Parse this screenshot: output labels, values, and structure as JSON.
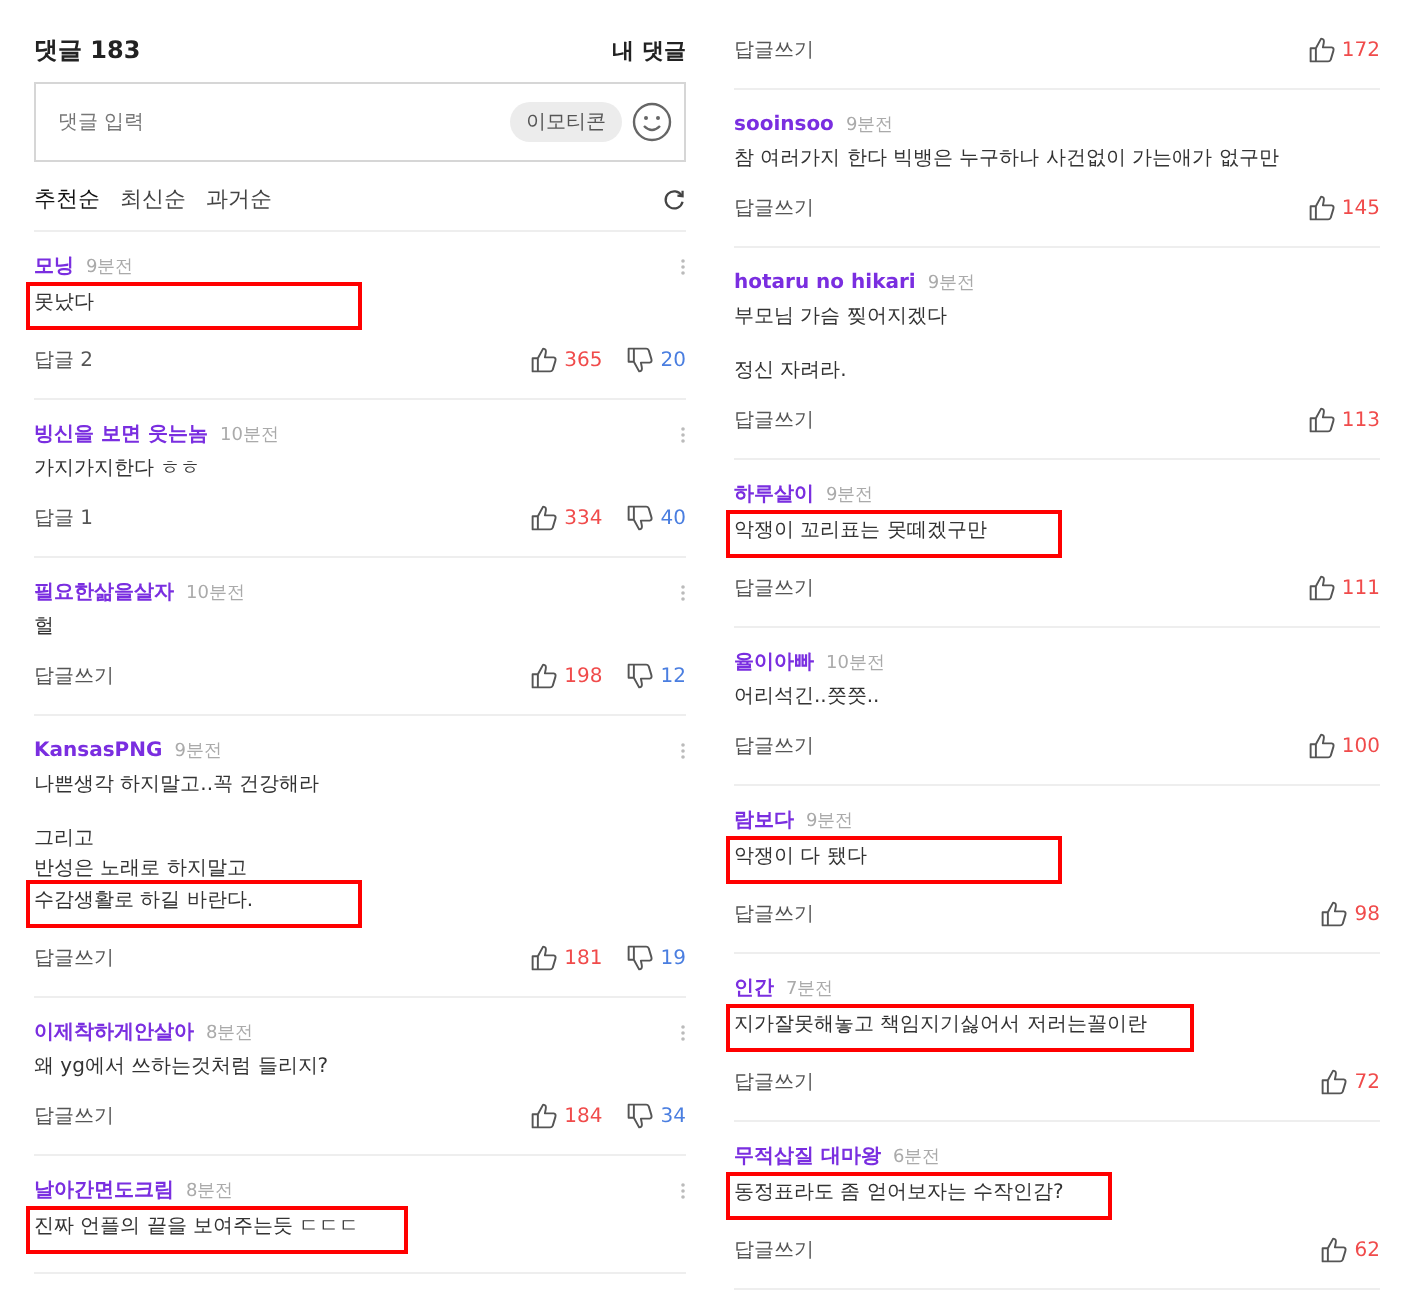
{
  "left_panel": {
    "header": {
      "title": "댓글 183",
      "my_comments": "내 댓글"
    },
    "input": {
      "placeholder": "댓글 입력",
      "emoticon": "이모티콘"
    },
    "sort_tabs": [
      {
        "label": "추천순",
        "selected": true
      },
      {
        "label": "최신순",
        "selected": false
      },
      {
        "label": "과거순",
        "selected": false
      }
    ],
    "show_menu": true,
    "comments": [
      {
        "author": "모닝",
        "time": "9분전",
        "lines": [
          {
            "kind": "text",
            "text": "못났다",
            "highlighted": true
          }
        ],
        "reply": "답글 2",
        "likes": "365",
        "dislikes": "20"
      },
      {
        "author": "빙신을 보면 웃는놈",
        "time": "10분전",
        "lines": [
          {
            "kind": "text",
            "text": "가지가지한다 ㅎㅎ",
            "highlighted": false
          }
        ],
        "reply": "답글 1",
        "likes": "334",
        "dislikes": "40"
      },
      {
        "author": "필요한삶을살자",
        "time": "10분전",
        "lines": [
          {
            "kind": "text",
            "text": "헐",
            "highlighted": false
          }
        ],
        "reply": "답글쓰기",
        "likes": "198",
        "dislikes": "12"
      },
      {
        "author": "KansasPNG",
        "time": "9분전",
        "lines": [
          {
            "kind": "text",
            "text": "나쁜생각 하지말고..꼭 건강해라",
            "highlighted": false
          },
          {
            "kind": "blank"
          },
          {
            "kind": "text",
            "text": "그리고",
            "highlighted": false
          },
          {
            "kind": "text",
            "text": "반성은 노래로 하지말고",
            "highlighted": false
          },
          {
            "kind": "text",
            "text": "수감생활로 하길 바란다.",
            "highlighted": true
          }
        ],
        "reply": "답글쓰기",
        "likes": "181",
        "dislikes": "19"
      },
      {
        "author": "이제착하게안살아",
        "time": "8분전",
        "lines": [
          {
            "kind": "text",
            "text": "왜 yg에서 쓰하는것처럼 들리지?",
            "highlighted": false
          }
        ],
        "reply": "답글쓰기",
        "likes": "184",
        "dislikes": "34"
      },
      {
        "author": "날아간면도크림",
        "time": "8분전",
        "lines": [
          {
            "kind": "text",
            "text": "진짜 언플의 끝을 보여주는듯 ㄷㄷㄷ",
            "highlighted": true
          }
        ]
      }
    ]
  },
  "right_panel": {
    "show_menu": false,
    "comments": [
      {
        "reply": "답글쓰기",
        "likes": "172"
      },
      {
        "author": "sooinsoo",
        "time": "9분전",
        "lines": [
          {
            "kind": "text",
            "text": "참 여러가지 한다 빅뱅은 누구하나 사건없이 가는애가 없구만",
            "highlighted": false
          }
        ],
        "reply": "답글쓰기",
        "likes": "145"
      },
      {
        "author": "hotaru no hikari",
        "time": "9분전",
        "lines": [
          {
            "kind": "text",
            "text": "부모님 가슴 찢어지겠다",
            "highlighted": false
          },
          {
            "kind": "blank"
          },
          {
            "kind": "text",
            "text": "정신 자려라.",
            "highlighted": false
          }
        ],
        "reply": "답글쓰기",
        "likes": "113"
      },
      {
        "author": "하루살이",
        "time": "9분전",
        "lines": [
          {
            "kind": "text",
            "text": "악쟁이 꼬리표는 못떼겠구만",
            "highlighted": true
          }
        ],
        "reply": "답글쓰기",
        "likes": "111"
      },
      {
        "author": "율이아빠",
        "time": "10분전",
        "lines": [
          {
            "kind": "text",
            "text": "어리석긴..쯧쯧..",
            "highlighted": false
          }
        ],
        "reply": "답글쓰기",
        "likes": "100"
      },
      {
        "author": "람보다",
        "time": "9분전",
        "lines": [
          {
            "kind": "text",
            "text": "악쟁이  다 됐다",
            "highlighted": true
          }
        ],
        "reply": "답글쓰기",
        "likes": "98"
      },
      {
        "author": "인간",
        "time": "7분전",
        "lines": [
          {
            "kind": "text",
            "text": "지가잘못해놓고 책임지기싫어서 저러는꼴이란",
            "highlighted": true
          }
        ],
        "reply": "답글쓰기",
        "likes": "72"
      },
      {
        "author": "무적삽질 대마왕",
        "time": "6분전",
        "lines": [
          {
            "kind": "text",
            "text": "동정표라도 좀 얻어보자는 수작인감?",
            "highlighted": true
          }
        ],
        "reply": "답글쓰기",
        "likes": "62"
      }
    ]
  }
}
